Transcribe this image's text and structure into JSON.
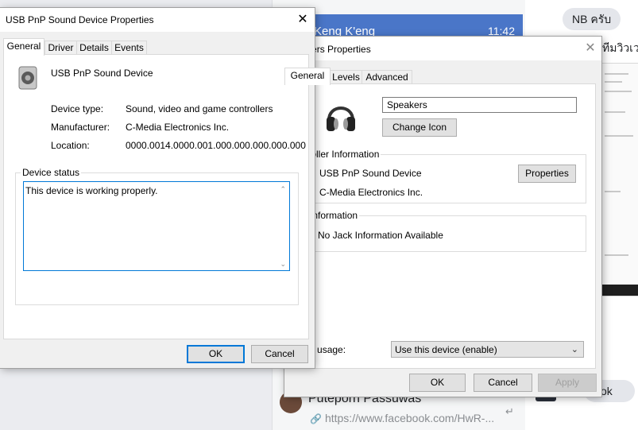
{
  "background": {
    "chat_active_name": "Keng K'eng",
    "chat_active_time": "11:42",
    "top_bubble": "NB ครับ",
    "right_thai_text": "ทีมวิวเว",
    "bottom_bubble": "ok",
    "contact_name": "Puteporn Passuwas",
    "contact_link": "https://www.facebook.com/HwR-..."
  },
  "speakers_dialog": {
    "title": "Speakers Properties",
    "tabs": [
      "General",
      "Levels",
      "Advanced"
    ],
    "name_value": "Speakers",
    "change_icon_label": "Change Icon",
    "controller_group_label": "Controller Information",
    "controller_device": "USB PnP Sound Device",
    "controller_vendor": "C-Media Electronics Inc.",
    "properties_label": "Properties",
    "jack_group_label": "Jack Information",
    "jack_info": "No Jack Information Available",
    "device_usage_label": "Device usage:",
    "device_usage_value": "Use this device (enable)",
    "ok_label": "OK",
    "cancel_label": "Cancel",
    "apply_label": "Apply"
  },
  "usb_dialog": {
    "title": "USB PnP Sound Device Properties",
    "close_glyph": "✕",
    "tabs": [
      "General",
      "Driver",
      "Details",
      "Events"
    ],
    "device_name": "USB PnP Sound Device",
    "device_type_label": "Device type:",
    "device_type_value": "Sound, video and game controllers",
    "manufacturer_label": "Manufacturer:",
    "manufacturer_value": "C-Media Electronics Inc.",
    "location_label": "Location:",
    "location_value": "0000.0014.0000.001.000.000.000.000.000",
    "status_group_label": "Device status",
    "status_text": "This device is working properly.",
    "ok_label": "OK",
    "cancel_label": "Cancel"
  }
}
